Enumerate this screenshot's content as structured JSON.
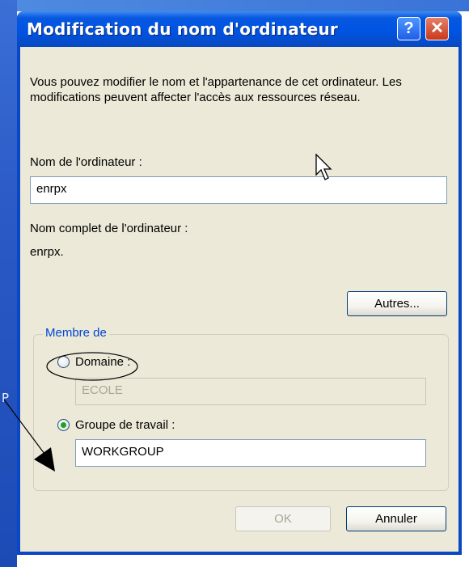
{
  "dialog": {
    "title": "Modification du nom d'ordinateur",
    "help_label": "?",
    "close_label": "✕",
    "description": "Vous pouvez modifier le nom et l'appartenance de cet ordinateur. Les modifications peuvent affecter l'accès aux ressources réseau.",
    "computer_name_label": "Nom de l'ordinateur :",
    "computer_name_value": "enrpx",
    "full_name_label": "Nom complet de l'ordinateur :",
    "full_name_value": "enrpx.",
    "more_button": "Autres...",
    "member_of": {
      "title": "Membre de",
      "domain_label": "Domaine :",
      "domain_value": "ECOLE",
      "domain_selected": false,
      "workgroup_label": "Groupe de travail :",
      "workgroup_value": "WORKGROUP",
      "workgroup_selected": true
    },
    "ok_button": "OK",
    "cancel_button": "Annuler"
  },
  "desktop": {
    "edge_text": "P"
  },
  "colors": {
    "titlebar": "#0054e3",
    "client_bg": "#ece9d8",
    "group_title": "#0046d5",
    "radio_dot": "#21a121"
  }
}
